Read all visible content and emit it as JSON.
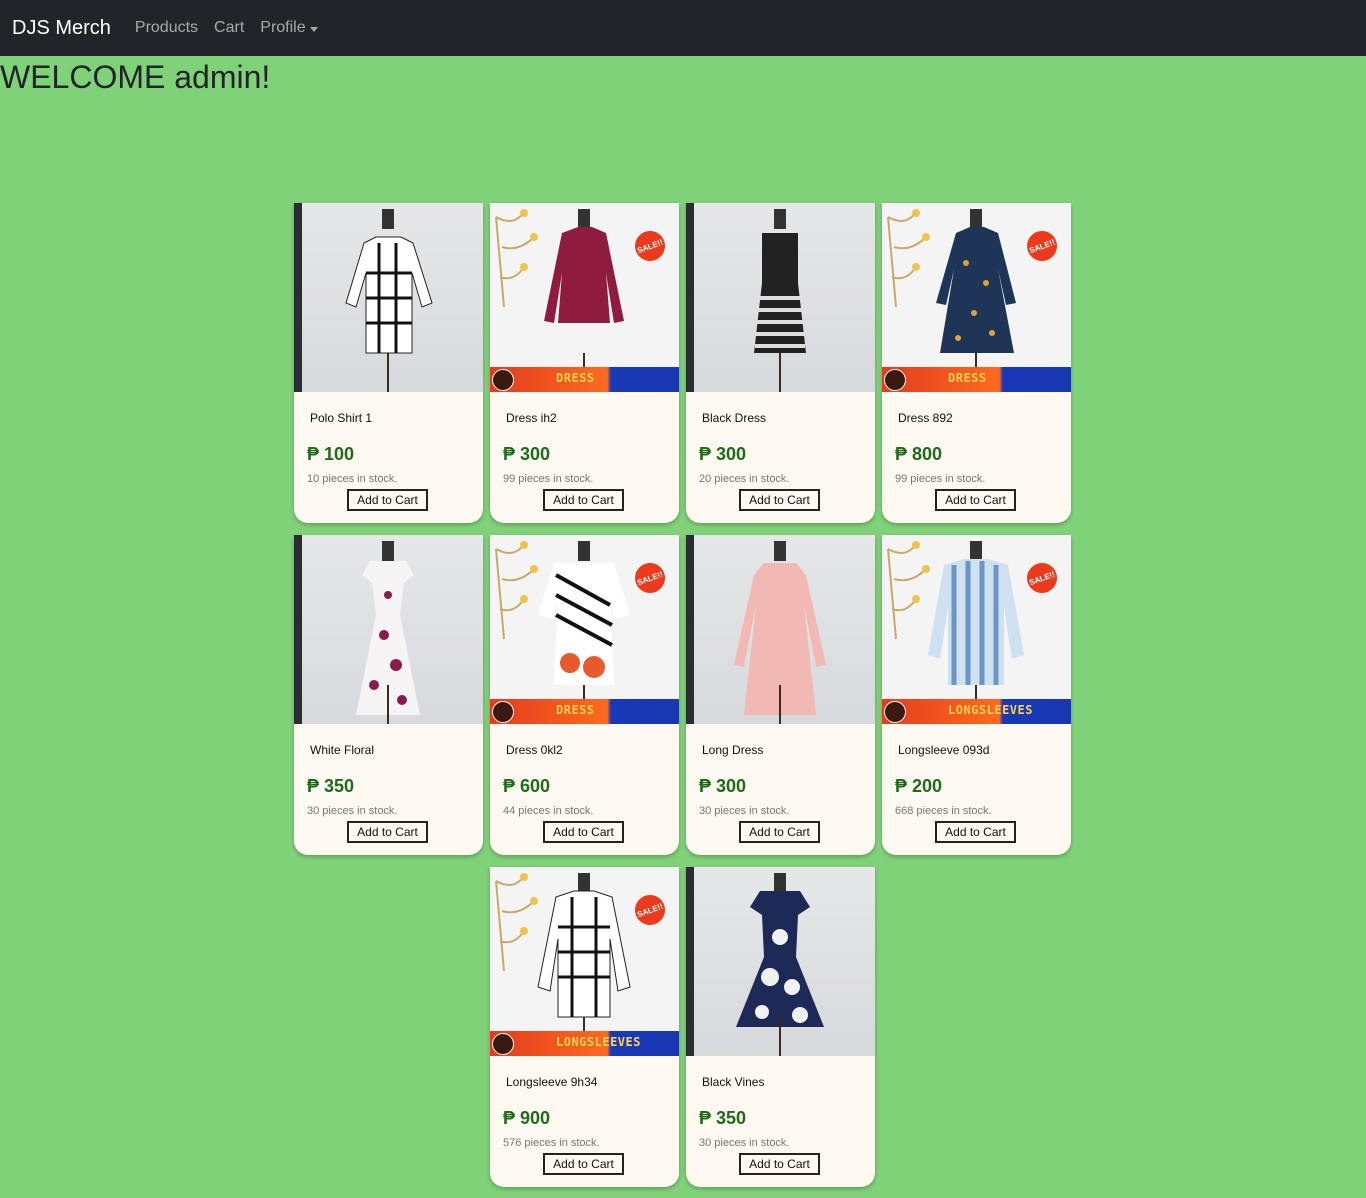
{
  "navbar": {
    "brand": "DJS Merch",
    "links": [
      "Products",
      "Cart"
    ],
    "profile": "Profile"
  },
  "welcome": "WELCOME admin!",
  "currency": "₱",
  "add_to_cart_label": "Add to Cart",
  "products": [
    {
      "name": "Polo Shirt 1",
      "price": "₱ 100",
      "stock": "10 pieces in stock.",
      "style": "plain",
      "garment": "check-shirt"
    },
    {
      "name": "Dress ih2",
      "price": "₱ 300",
      "stock": "99 pieces in stock.",
      "style": "sale",
      "banner": "DRESS",
      "sale": "SALE!!",
      "garment": "maroon-dress"
    },
    {
      "name": "Black Dress",
      "price": "₱ 300",
      "stock": "20 pieces in stock.",
      "style": "plain",
      "garment": "striped-dress"
    },
    {
      "name": "Dress 892",
      "price": "₱ 800",
      "stock": "99 pieces in stock.",
      "style": "sale",
      "banner": "DRESS",
      "sale": "SALE!!",
      "garment": "navy-dress"
    },
    {
      "name": "White Floral",
      "price": "₱ 350",
      "stock": "30 pieces in stock.",
      "style": "plain",
      "garment": "floral-dress"
    },
    {
      "name": "Dress 0kl2",
      "price": "₱ 600",
      "stock": "44 pieces in stock.",
      "style": "sale",
      "banner": "DRESS",
      "sale": "SALE!!",
      "garment": "zebra-dress"
    },
    {
      "name": "Long Dress",
      "price": "₱ 300",
      "stock": "30 pieces in stock.",
      "style": "plain",
      "garment": "pink-dress"
    },
    {
      "name": "Longsleeve 093d",
      "price": "₱ 200",
      "stock": "668 pieces in stock.",
      "style": "sale",
      "banner": "LONGSLEEVES",
      "sale": "SALE!!",
      "garment": "blue-stripe-shirt"
    },
    {
      "name": "Longsleeve 9h34",
      "price": "₱ 900",
      "stock": "576 pieces in stock.",
      "style": "sale",
      "banner": "LONGSLEEVES",
      "sale": "SALE!!",
      "garment": "plaid-shirt"
    },
    {
      "name": "Black Vines",
      "price": "₱ 350",
      "stock": "30 pieces in stock.",
      "style": "plain",
      "garment": "vine-dress"
    }
  ]
}
